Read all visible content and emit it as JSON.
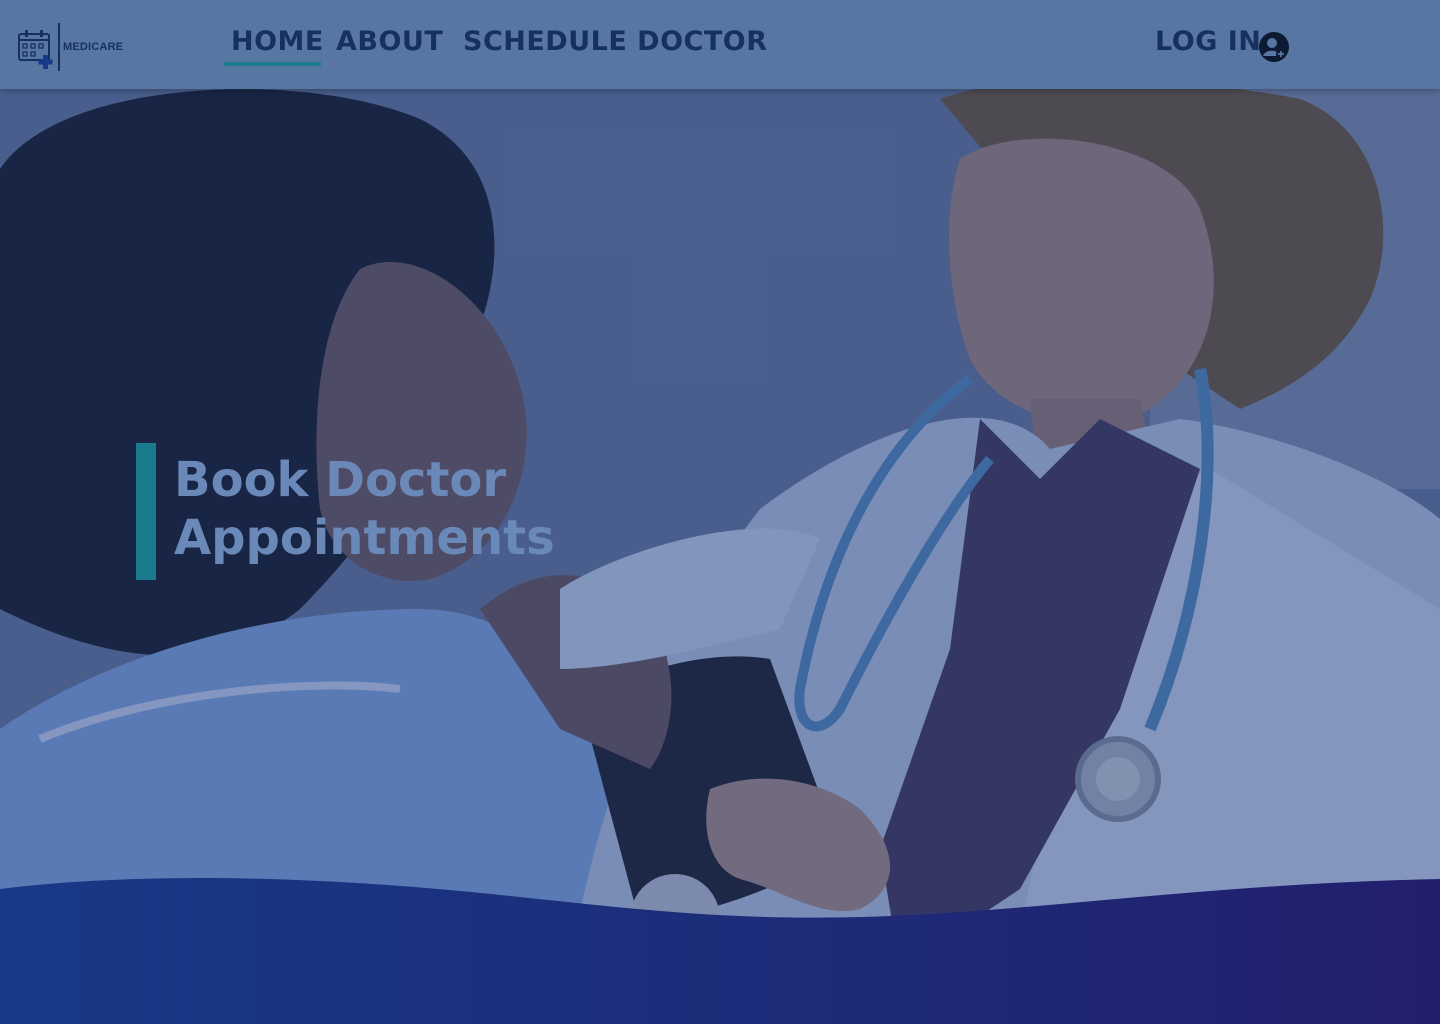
{
  "brand": {
    "name": "MEDICARE",
    "logo_icon": "calendar-medical-icon"
  },
  "nav": {
    "home": "HOME",
    "about": "ABOUT",
    "schedule": "SCHEDULE DOCTOR",
    "login": "LOG IN",
    "login_icon": "user-avatar-icon",
    "active": "HOME"
  },
  "hero": {
    "title_line1": "Book Doctor",
    "title_line2": "Appointments"
  },
  "colors": {
    "header_bg": "#5776a2",
    "nav_text": "#17305e",
    "accent": "#1a7b8c",
    "hero_text": "#6b89b8",
    "wave_start": "#173a86",
    "wave_end": "#221f6e"
  }
}
